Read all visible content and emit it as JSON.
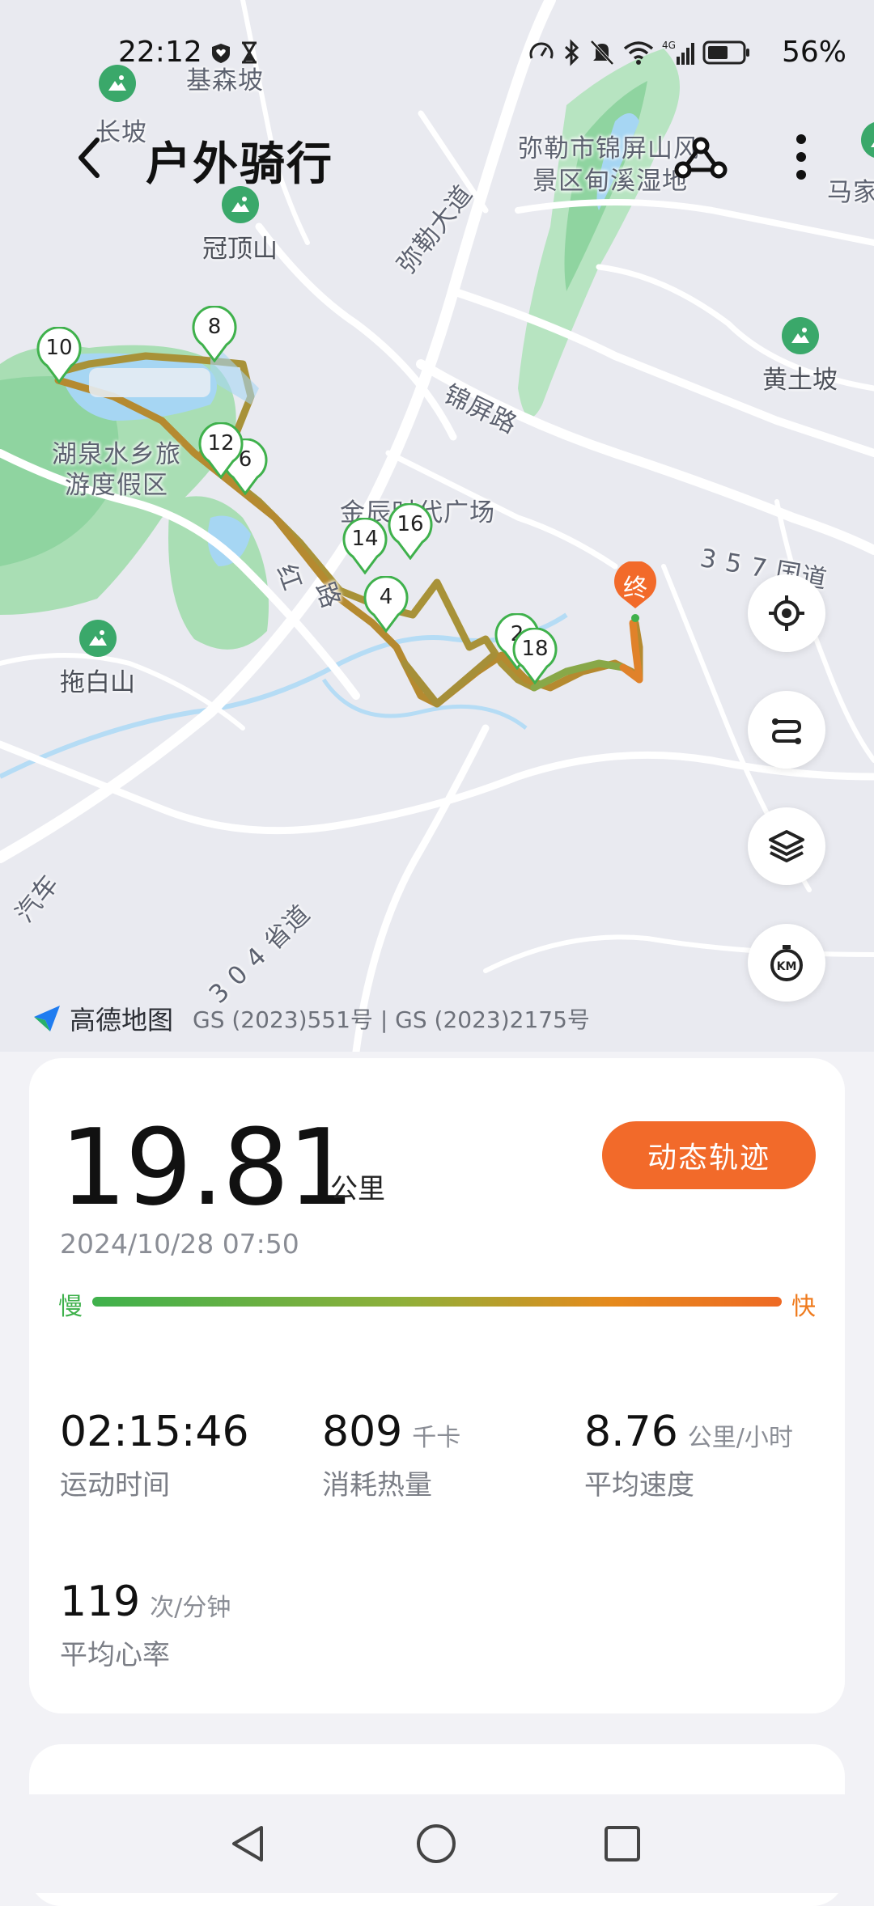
{
  "status_bar": {
    "time": "22:12",
    "battery": "56%",
    "left_icons": [
      "heart-shield-icon",
      "hourglass-icon"
    ],
    "right_icons": [
      "speed-icon",
      "bluetooth-icon",
      "mute-icon",
      "wifi-icon",
      "signal-4g-icon",
      "battery-icon"
    ]
  },
  "header": {
    "title": "户外骑行"
  },
  "map": {
    "labels": {
      "jisenpo": "基森坡",
      "changpo": "长坡",
      "guandingshan": "冠顶山",
      "scenic1": "弥勒市锦屏山风",
      "scenic2": "景区甸溪湿地",
      "majia": "马家",
      "mile_ave": "弥勒大道",
      "jinping_rd": "锦屏路",
      "huangtupo": "黄土坡",
      "hu1": "湖泉水乡旅",
      "hu2": "游度假区",
      "jinchen": "金辰时代广场",
      "guodao": "3 5 7 国道",
      "tuobaishan": "拖白山",
      "hong": "红",
      "road_s": "路",
      "qiche": "汽车",
      "shengdao": "3 0 4 省道"
    },
    "km_markers": [
      "10",
      "8",
      "12",
      "6",
      "16",
      "14",
      "4",
      "2",
      "18"
    ],
    "end_label": "终"
  },
  "attribution": {
    "brand": "高德地图",
    "license": "GS (2023)551号 | GS (2023)2175号"
  },
  "summary": {
    "distance": "19.81",
    "distance_unit": "公里",
    "replay_button": "动态轨迹",
    "datetime": "2024/10/28 07:50",
    "speed_slow": "慢",
    "speed_fast": "快",
    "stats": [
      {
        "value": "02:15:46",
        "unit": "",
        "label": "运动时间"
      },
      {
        "value": "809",
        "unit": "千卡",
        "label": "消耗热量"
      },
      {
        "value": "8.76",
        "unit": "公里/小时",
        "label": "平均速度"
      },
      {
        "value": "119",
        "unit": "次/分钟",
        "label": "平均心率"
      }
    ]
  },
  "colors": {
    "accent": "#f26a2a",
    "slow": "#3fb14c",
    "fast": "#ef7a1c",
    "route": "#a8963a",
    "park": "#8fd4a0",
    "water": "#a6d6f3"
  }
}
